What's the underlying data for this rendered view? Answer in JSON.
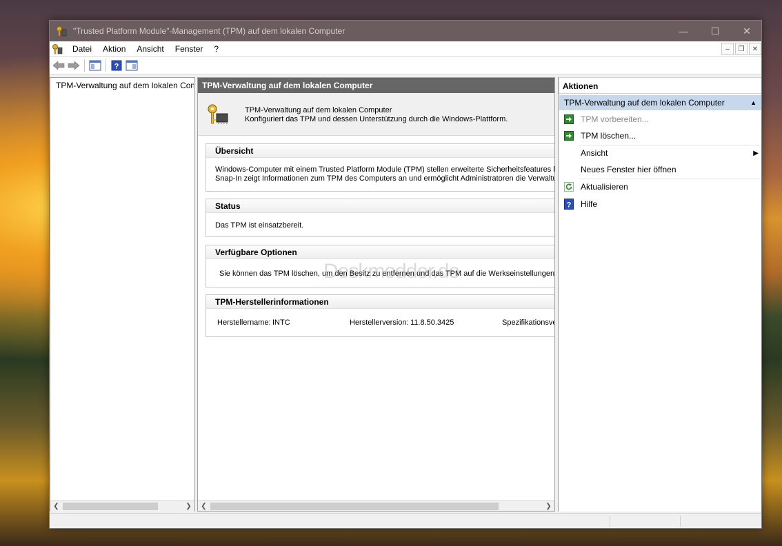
{
  "window": {
    "title": "\"Trusted Platform Module\"-Management (TPM) auf dem lokalen Computer",
    "controls": {
      "minimize": "—",
      "maximize": "☐",
      "close": "✕"
    }
  },
  "menu": {
    "items": [
      "Datei",
      "Aktion",
      "Ansicht",
      "Fenster",
      "?"
    ]
  },
  "tree": {
    "root": "TPM-Verwaltung auf dem lokalen Computer"
  },
  "center": {
    "header": "TPM-Verwaltung auf dem lokalen Computer",
    "intro_title": "TPM-Verwaltung auf dem lokalen Computer",
    "intro_desc": "Konfiguriert das TPM und dessen Unterstützung durch die Windows-Plattform.",
    "overview": {
      "heading": "Übersicht",
      "line1": "Windows-Computer mit einem Trusted Platform Module (TPM) stellen erweiterte Sicherheitsfeatures bereit",
      "line2": "Snap-In zeigt Informationen zum TPM des Computers an und ermöglicht Administratoren die Verwaltung d"
    },
    "status": {
      "heading": "Status",
      "text": "Das TPM ist einsatzbereit."
    },
    "options": {
      "heading": "Verfügbare Optionen",
      "text": "Sie können das TPM löschen, um den Besitz zu entfernen und das TPM auf die Werkseinstellungen zu"
    },
    "manufacturer": {
      "heading": "TPM-Herstellerinformationen",
      "name_label": "Herstellername:",
      "name_value": "INTC",
      "version_label": "Herstellerversion:",
      "version_value": "11.8.50.3425",
      "spec_label": "Spezifikationsve"
    },
    "watermark": "Deskmodder.de"
  },
  "actions": {
    "heading": "Aktionen",
    "group": "TPM-Verwaltung auf dem lokalen Computer",
    "items": [
      {
        "label": "TPM vorbereiten...",
        "icon": "green-arrow-icon",
        "enabled": false
      },
      {
        "label": "TPM löschen...",
        "icon": "green-arrow-icon",
        "enabled": true
      },
      {
        "label": "Ansicht",
        "icon": "none",
        "enabled": true,
        "submenu": true
      },
      {
        "label": "Neues Fenster hier öffnen",
        "icon": "none",
        "enabled": true
      },
      {
        "label": "Aktualisieren",
        "icon": "refresh-icon",
        "enabled": true
      },
      {
        "label": "Hilfe",
        "icon": "help-icon",
        "enabled": true
      }
    ]
  },
  "colors": {
    "titlebar": "#6b5d5f",
    "center_header": "#666666",
    "actions_group": "#c8d8ec",
    "action_icon_green": "#2e8b2e",
    "help_blue": "#2b4fb8"
  }
}
